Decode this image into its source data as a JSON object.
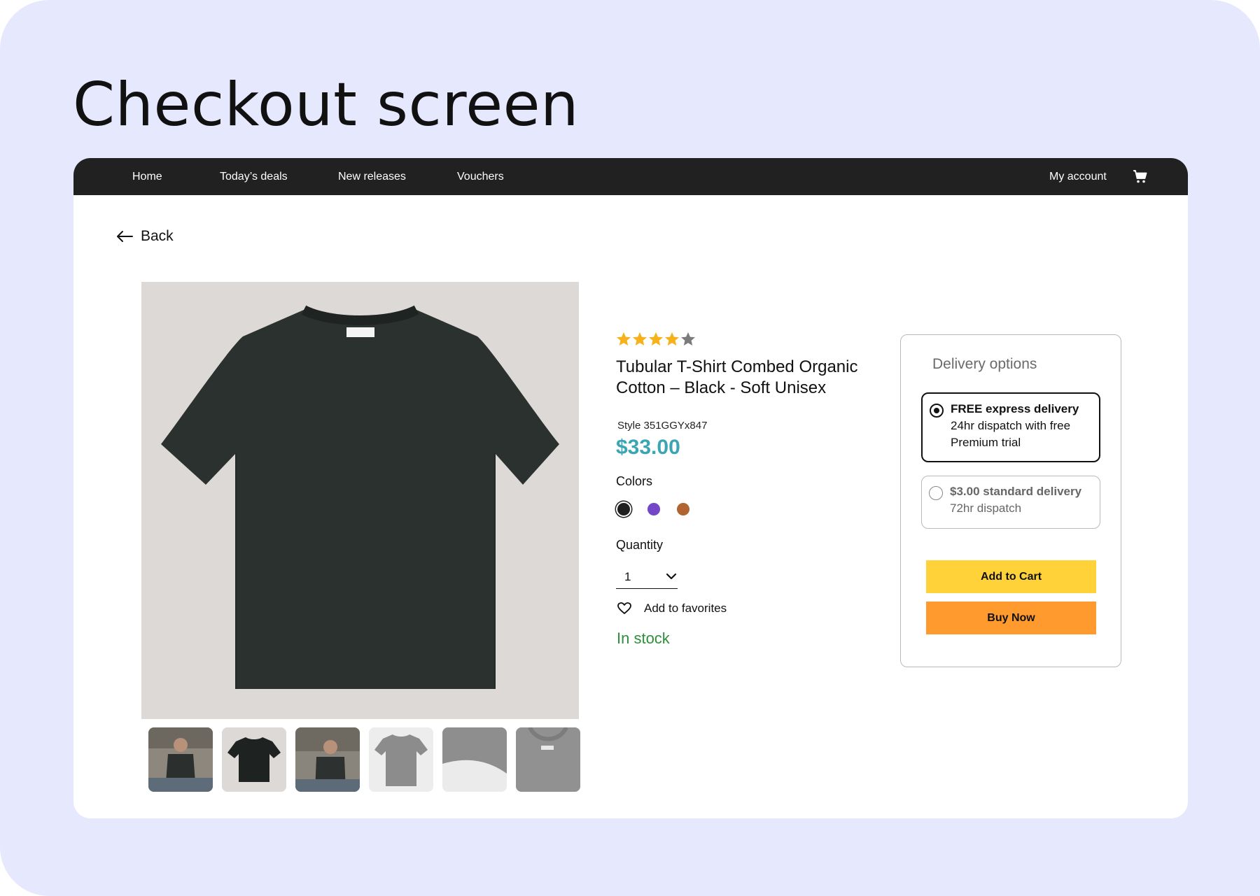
{
  "page": {
    "title": "Checkout screen"
  },
  "nav": {
    "items": [
      "Home",
      "Today’s deals",
      "New releases",
      "Vouchers"
    ],
    "account": "My account",
    "cart_icon": "cart-icon"
  },
  "back": {
    "label": "Back",
    "icon": "arrow-left-icon"
  },
  "product": {
    "rating": 4,
    "rating_max": 5,
    "title": "Tubular T-Shirt Combed Organic Cotton – Black - Soft Unisex",
    "style": "Style 351GGYx847",
    "price": "$33.00",
    "colors_label": "Colors",
    "colors": [
      "#1f1f1f",
      "#7446c8",
      "#b06432"
    ],
    "selected_color_index": 0,
    "quantity_label": "Quantity",
    "quantity": "1",
    "favorites_label": "Add to favorites",
    "stock": "In stock"
  },
  "delivery": {
    "title": "Delivery options",
    "options": [
      {
        "strong": "FREE express delivery",
        "text": "24hr dispatch with free Premium trial",
        "selected": true
      },
      {
        "strong": "$3.00 standard delivery",
        "text": "72hr dispatch",
        "selected": false
      }
    ]
  },
  "actions": {
    "add_to_cart": "Add to Cart",
    "buy_now": "Buy Now"
  },
  "colors": {
    "accent_price": "#3aa6b4",
    "in_stock": "#2d8f3a",
    "add_to_cart": "#ffd239",
    "buy_now": "#ff9a2e",
    "nav_bg": "#212121"
  }
}
